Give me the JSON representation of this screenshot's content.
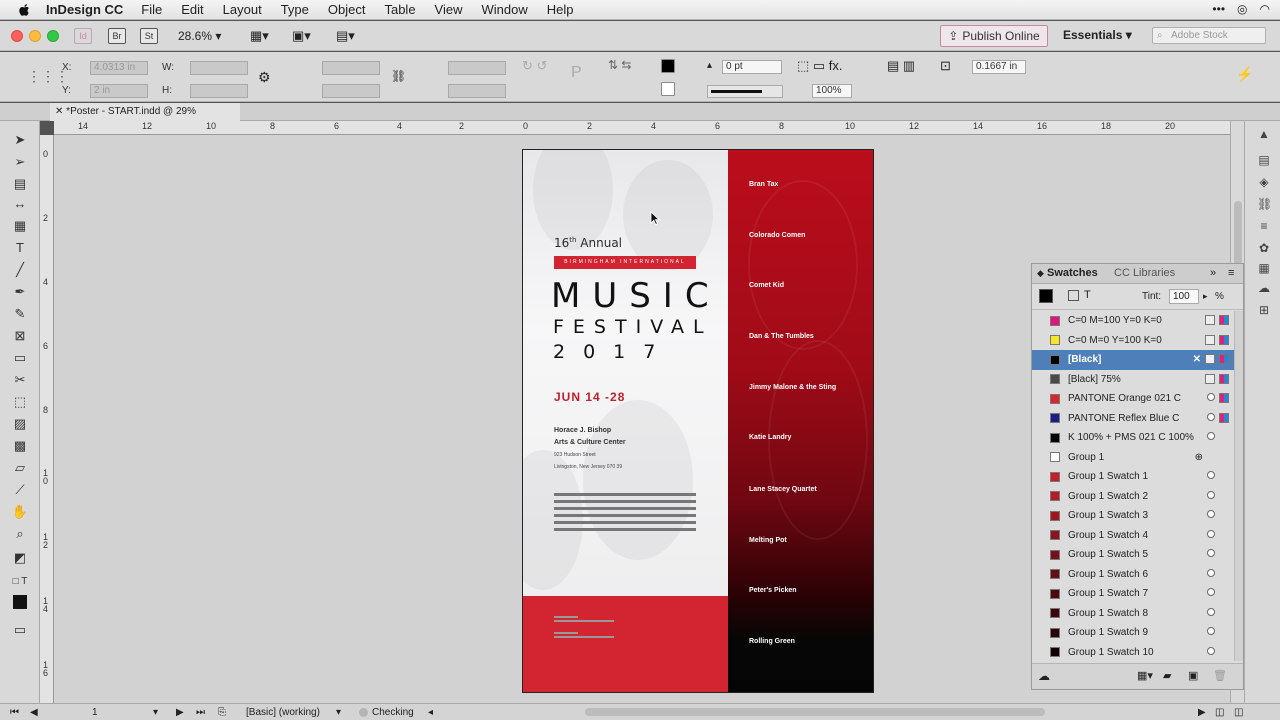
{
  "menubar": {
    "app_name": "InDesign CC",
    "items": [
      "File",
      "Edit",
      "Layout",
      "Type",
      "Object",
      "Table",
      "View",
      "Window",
      "Help"
    ],
    "status_icons": [
      "more-icon",
      "creative-cloud-icon",
      "wifi-icon"
    ]
  },
  "appbar": {
    "br_label": "Br",
    "st_label": "St",
    "zoom": "28.6%",
    "publish_label": "Publish Online",
    "workspace": "Essentials",
    "search_placeholder": "Adobe Stock"
  },
  "control": {
    "x_label": "X:",
    "y_label": "Y:",
    "w_label": "W:",
    "h_label": "H:",
    "x_value": "4.0313 in",
    "y_value": "2 in",
    "stroke_weight": "0 pt",
    "opacity": "100%",
    "offset_value": "0.1667 in"
  },
  "document": {
    "tab_title": "*Poster - START.indd @ 29%"
  },
  "rulers": {
    "h_labels": [
      "14",
      "12",
      "10",
      "8",
      "6",
      "4",
      "2",
      "0",
      "2",
      "4",
      "6",
      "8",
      "10",
      "12",
      "14",
      "16",
      "18",
      "20"
    ],
    "v_labels": [
      "0",
      "2",
      "4",
      "6",
      "8",
      "1\n0",
      "1\n2",
      "1\n4",
      "1\n6"
    ]
  },
  "poster": {
    "annual_number": "16",
    "annual_suffix": "th",
    "annual_word": "Annual",
    "banner": "BIRMINGHAM INTERNATIONAL",
    "title_line1": "MUSIC",
    "title_line2": "FESTIVAL",
    "title_line3": "2017",
    "date": "JUN 14 -28",
    "venue_line1": "Horace J. Bishop",
    "venue_line2": "Arts & Culture Center",
    "address_line1": "923 Hudson Street",
    "address_line2": "Livingston, New Jersey 070 39",
    "bands": [
      "Bran Tax",
      "Colorado Comen",
      "Comet Kid",
      "Dan & The Tumbles",
      "Jimmy Malone & the Sting",
      "Katie Landry",
      "Lane Stacey Quartet",
      "Melting Pot",
      "Peter's Picken",
      "Rolling Green"
    ],
    "colors": {
      "red": "#d32531",
      "dark_red": "#a00b17",
      "black": "#050505"
    }
  },
  "swatches_panel": {
    "tab_active": "Swatches",
    "tab_inactive": "CC Libraries",
    "tint_label": "Tint:",
    "tint_value": "100",
    "tint_unit": "%",
    "swatches": [
      {
        "name": "C=0 M=100 Y=0 K=0",
        "color": "#e0157e",
        "type": "cmyk"
      },
      {
        "name": "C=0 M=0 Y=100 K=0",
        "color": "#f7e627",
        "type": "cmyk"
      },
      {
        "name": "[Black]",
        "color": "#000000",
        "type": "cmyk",
        "selected": true
      },
      {
        "name": "[Black] 75%",
        "color": "#4a4a4a",
        "type": "cmyk"
      },
      {
        "name": "PANTONE Orange 021 C",
        "color": "#d8262f",
        "type": "spot"
      },
      {
        "name": "PANTONE Reflex Blue C",
        "color": "#1b1e86",
        "type": "spot"
      },
      {
        "name": "K 100% + PMS 021 C 100%",
        "color": "#050505",
        "type": "mixed"
      },
      {
        "name": "Group 1",
        "color": "#ffffff",
        "type": "group"
      },
      {
        "name": "Group 1 Swatch 1",
        "color": "#c51e2a",
        "type": "mixed"
      },
      {
        "name": "Group 1 Swatch 2",
        "color": "#b21a25",
        "type": "mixed"
      },
      {
        "name": "Group 1 Swatch 3",
        "color": "#9f1620",
        "type": "mixed"
      },
      {
        "name": "Group 1 Swatch 4",
        "color": "#8b131c",
        "type": "mixed"
      },
      {
        "name": "Group 1 Swatch 5",
        "color": "#771018",
        "type": "mixed"
      },
      {
        "name": "Group 1 Swatch 6",
        "color": "#630d14",
        "type": "mixed"
      },
      {
        "name": "Group 1 Swatch 7",
        "color": "#4f0a10",
        "type": "mixed"
      },
      {
        "name": "Group 1 Swatch 8",
        "color": "#3b070c",
        "type": "mixed"
      },
      {
        "name": "Group 1 Swatch 9",
        "color": "#270508",
        "type": "mixed"
      },
      {
        "name": "Group 1 Swatch 10",
        "color": "#130204",
        "type": "mixed"
      }
    ]
  },
  "statusbar": {
    "page_number": "1",
    "preflight_profile": "[Basic] (working)",
    "preflight_status": "Checking"
  }
}
